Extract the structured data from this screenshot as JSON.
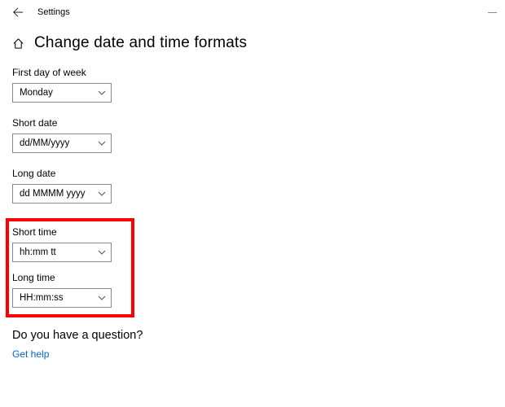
{
  "titlebar": {
    "app_name": "Settings"
  },
  "header": {
    "title": "Change date and time formats"
  },
  "fields": {
    "first_day": {
      "label": "First day of week",
      "value": "Monday"
    },
    "short_date": {
      "label": "Short date",
      "value": "dd/MM/yyyy"
    },
    "long_date": {
      "label": "Long date",
      "value": "dd MMMM yyyy"
    },
    "short_time": {
      "label": "Short time",
      "value": "hh:mm tt"
    },
    "long_time": {
      "label": "Long time",
      "value": "HH:mm:ss"
    }
  },
  "footer": {
    "question": "Do you have a question?",
    "help_link": "Get help"
  }
}
